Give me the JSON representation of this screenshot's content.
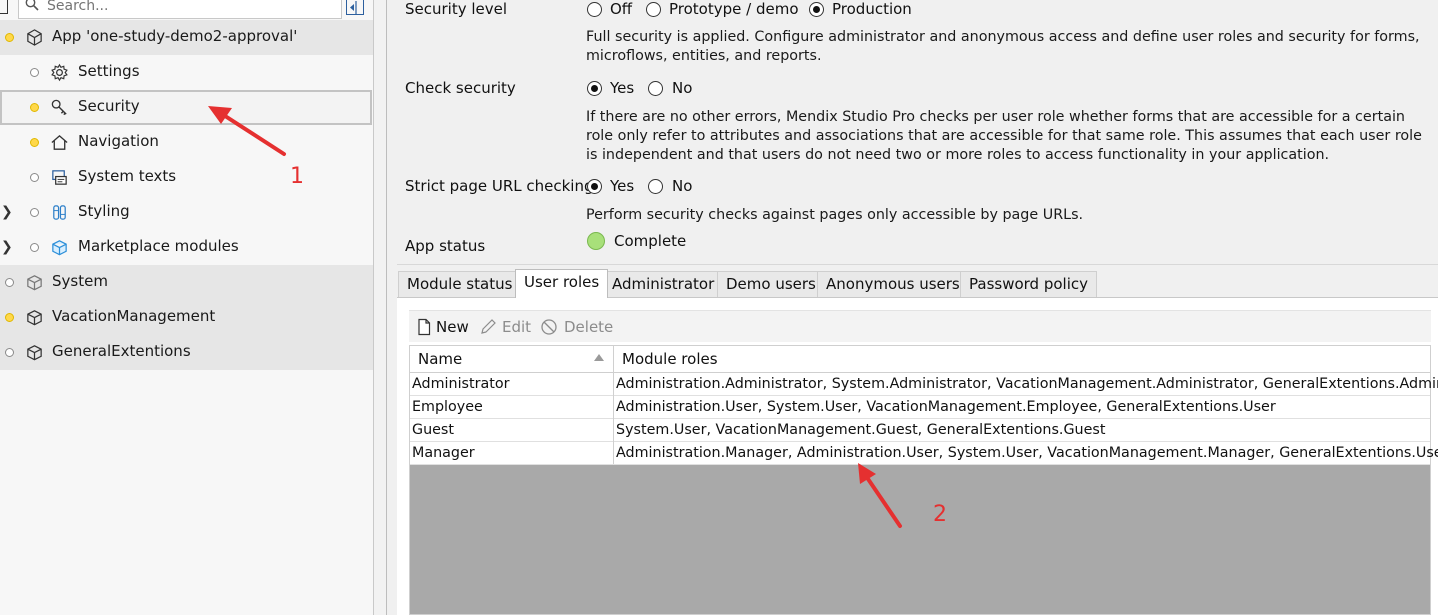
{
  "search": {
    "placeholder": "Search..."
  },
  "tree": {
    "app": {
      "label": "App 'one-study-demo2-approval'"
    },
    "items": [
      {
        "label": "Settings",
        "icon": "gear-icon"
      },
      {
        "label": "Security",
        "icon": "key-icon"
      },
      {
        "label": "Navigation",
        "icon": "home-icon"
      },
      {
        "label": "System texts",
        "icon": "system-texts-icon"
      },
      {
        "label": "Styling",
        "icon": "styling-icon"
      },
      {
        "label": "Marketplace modules",
        "icon": "marketplace-icon"
      }
    ],
    "modules": [
      {
        "label": "System",
        "icon": "module-icon"
      },
      {
        "label": "VacationManagement",
        "icon": "module-icon"
      },
      {
        "label": "GeneralExtentions",
        "icon": "module-icon"
      }
    ]
  },
  "settings": {
    "security_level": {
      "label": "Security level",
      "options": [
        "Off",
        "Prototype / demo",
        "Production"
      ],
      "selected": "Production",
      "description": "Full security is applied. Configure administrator and anonymous access and define user roles and security for forms, microflows, entities, and reports."
    },
    "check_security": {
      "label": "Check security",
      "options": [
        "Yes",
        "No"
      ],
      "selected": "Yes",
      "description": "If there are no other errors, Mendix Studio Pro checks per user role whether forms that are accessible for a certain role only refer to attributes and associations that are accessible for that same role. This assumes that each user role is independent and that users do not need two or more roles to access functionality in your application."
    },
    "strict_url": {
      "label": "Strict page URL checking",
      "options": [
        "Yes",
        "No"
      ],
      "selected": "Yes",
      "description": "Perform security checks against pages only accessible by page URLs."
    },
    "app_status": {
      "label": "App status",
      "value": "Complete",
      "color": "#a8e07a"
    }
  },
  "tabs": [
    {
      "label": "Module status"
    },
    {
      "label": "User roles",
      "active": true
    },
    {
      "label": "Administrator"
    },
    {
      "label": "Demo users"
    },
    {
      "label": "Anonymous users"
    },
    {
      "label": "Password policy"
    }
  ],
  "toolbar": {
    "new_label": "New",
    "edit_label": "Edit",
    "delete_label": "Delete"
  },
  "grid": {
    "columns": [
      "Name",
      "Module roles"
    ],
    "rows": [
      {
        "name": "Administrator",
        "roles": "Administration.Administrator, System.Administrator, VacationManagement.Administrator, GeneralExtentions.Administrator"
      },
      {
        "name": "Employee",
        "roles": "Administration.User, System.User, VacationManagement.Employee, GeneralExtentions.User"
      },
      {
        "name": "Guest",
        "roles": "System.User, VacationManagement.Guest, GeneralExtentions.Guest"
      },
      {
        "name": "Manager",
        "roles": "Administration.Manager, Administration.User, System.User, VacationManagement.Manager, GeneralExtentions.User"
      }
    ]
  },
  "annotations": {
    "one": "1",
    "two": "2",
    "color": "#e53030"
  }
}
